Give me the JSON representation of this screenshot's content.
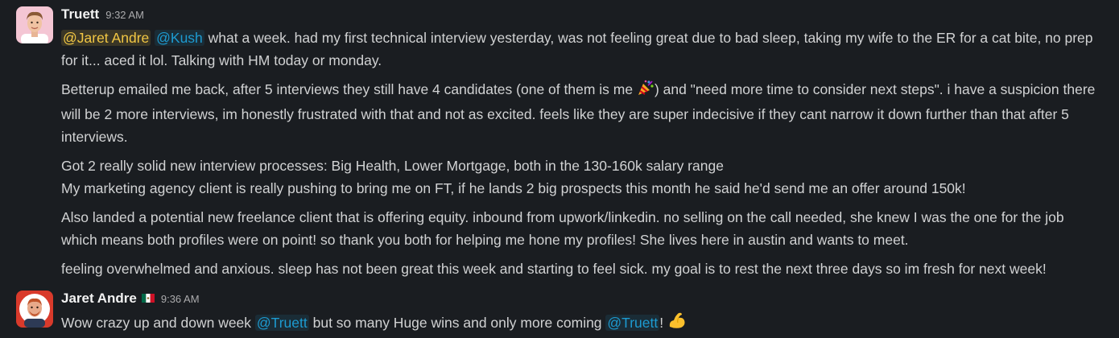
{
  "messages": [
    {
      "author": "Truett",
      "time": "9:32 AM",
      "mentions": [
        "@Jaret Andre",
        "@Kush"
      ],
      "paragraphs": {
        "p1_rest": " what a week. had my first technical interview yesterday, was not feeling great due to bad sleep, taking my wife to the ER for a cat bite, no prep for it... aced it lol. Talking with HM today or monday.",
        "p2_a": "Betterup emailed me back, after 5 interviews they still have 4 candidates (one of them is me ",
        "p2_b": ") and \"need more time to consider next steps\". i have a suspicion there will be 2 more interviews, im honestly frustrated with that and not as excited. feels like they are super indecisive if they cant narrow it down further than that after 5 interviews.",
        "p3_line1": "Got 2 really solid new interview processes: Big Health, Lower Mortgage, both in the 130-160k salary range",
        "p3_line2": "My marketing agency client is really pushing to bring me on FT, if he lands 2 big prospects this month he said he'd send me an offer around 150k!",
        "p4": "Also landed a potential new freelance client that is offering equity. inbound from upwork/linkedin. no selling on the call needed, she knew I was the one for the job which means both profiles were on point! so thank you both for helping me hone my profiles! She lives here in austin and wants to meet.",
        "p5": "feeling overwhelmed and anxious. sleep has not been great this week and starting to feel sick. my goal is to rest the next three days so im fresh for next week!"
      },
      "emoji": "party-popper-icon"
    },
    {
      "author": "Jaret Andre",
      "time": "9:36 AM",
      "status_icon": "mexico-flag-icon",
      "text_a": "Wow crazy up and down week ",
      "mention_1": "@Truett",
      "text_b": " but so many Huge wins and only more coming ",
      "mention_2": "@Truett",
      "text_c": "!",
      "emoji": "flexed-biceps-icon"
    }
  ],
  "colors": {
    "background": "#1a1d21",
    "text": "#d1d2d3",
    "mention": "#1d9bd1",
    "self_mention": "#f2c744"
  }
}
